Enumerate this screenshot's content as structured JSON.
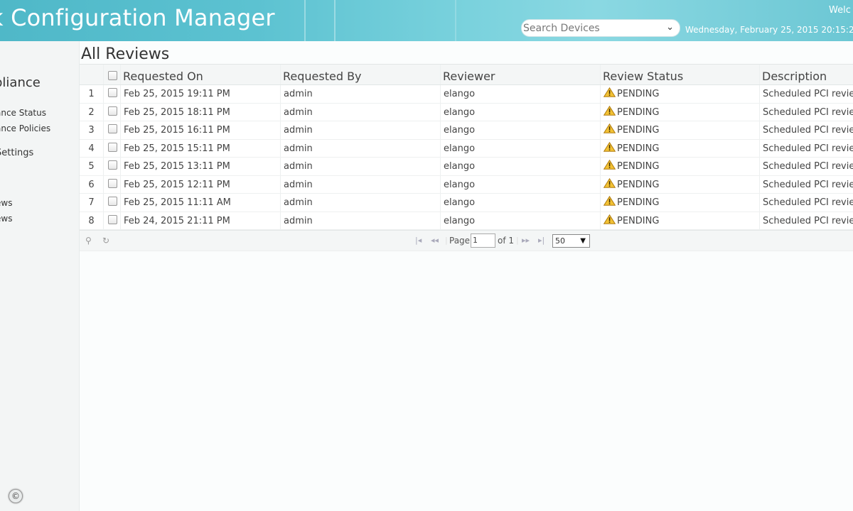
{
  "header": {
    "app_title": "k Configuration Manager",
    "search_placeholder": "Search Devices",
    "datetime": "Wednesday, February 25, 2015 20:15:2",
    "welcome": "Welc"
  },
  "sidebar": {
    "heading": "pliance",
    "links": [
      "ance Status",
      "ance Policies"
    ],
    "settings": "Settings",
    "links2": [
      "ews",
      "ews"
    ],
    "copyright": "©"
  },
  "page": {
    "title": "All Reviews"
  },
  "table": {
    "columns": [
      "Requested On",
      "Requested By",
      "Reviewer",
      "Review Status",
      "Description"
    ],
    "rows": [
      {
        "num": "1",
        "requested_on": "Feb 25, 2015 19:11 PM",
        "requested_by": "admin",
        "reviewer": "elango",
        "status": "PENDING",
        "description": "Scheduled PCI review"
      },
      {
        "num": "2",
        "requested_on": "Feb 25, 2015 18:11 PM",
        "requested_by": "admin",
        "reviewer": "elango",
        "status": "PENDING",
        "description": "Scheduled PCI review"
      },
      {
        "num": "3",
        "requested_on": "Feb 25, 2015 16:11 PM",
        "requested_by": "admin",
        "reviewer": "elango",
        "status": "PENDING",
        "description": "Scheduled PCI review"
      },
      {
        "num": "4",
        "requested_on": "Feb 25, 2015 15:11 PM",
        "requested_by": "admin",
        "reviewer": "elango",
        "status": "PENDING",
        "description": "Scheduled PCI review"
      },
      {
        "num": "5",
        "requested_on": "Feb 25, 2015 13:11 PM",
        "requested_by": "admin",
        "reviewer": "elango",
        "status": "PENDING",
        "description": "Scheduled PCI review"
      },
      {
        "num": "6",
        "requested_on": "Feb 25, 2015 12:11 PM",
        "requested_by": "admin",
        "reviewer": "elango",
        "status": "PENDING",
        "description": "Scheduled PCI review"
      },
      {
        "num": "7",
        "requested_on": "Feb 25, 2015 11:11 AM",
        "requested_by": "admin",
        "reviewer": "elango",
        "status": "PENDING",
        "description": "Scheduled PCI review"
      },
      {
        "num": "8",
        "requested_on": "Feb 24, 2015 21:11 PM",
        "requested_by": "admin",
        "reviewer": "elango",
        "status": "PENDING",
        "description": "Scheduled PCI review"
      }
    ]
  },
  "pager": {
    "page_label": "Page",
    "current_page": "1",
    "of_label": "of 1",
    "page_size": "50"
  },
  "icons": {
    "search": "search-icon",
    "refresh": "refresh-icon",
    "warning": "warning-icon"
  }
}
